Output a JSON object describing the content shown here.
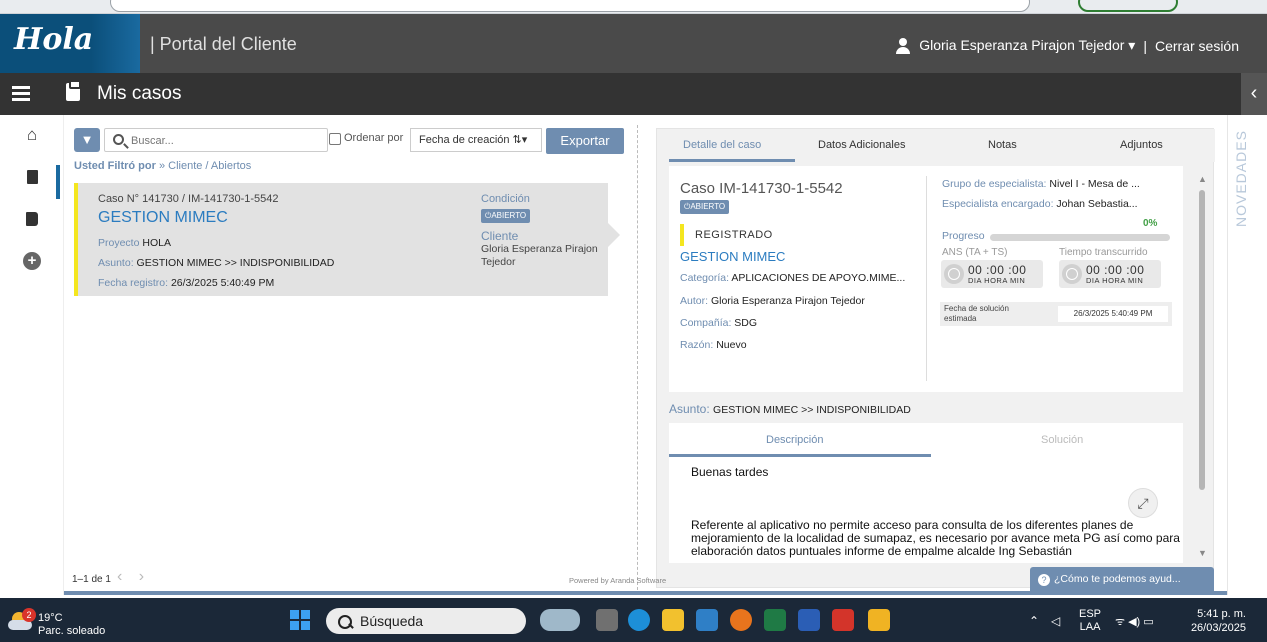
{
  "header": {
    "logo_text": "Hola",
    "portal_title": "| Portal del Cliente",
    "user_name": "Gloria Esperanza Pirajon Tejedor ▾",
    "separator": "|",
    "logout": "Cerrar sesión"
  },
  "subbar": {
    "title": "Mis casos"
  },
  "toolbar": {
    "search_placeholder": "Buscar...",
    "order_label": "Ordenar por",
    "order_value": "Fecha de creación ⇅▾",
    "export_label": "Exportar"
  },
  "filter": {
    "label": "Usted Filtró por",
    "value": " » Cliente / Abiertos"
  },
  "case_card": {
    "number": "Caso N° 141730 / IM-141730-1-5542",
    "title": "GESTION MIMEC",
    "project_label": "Proyecto ",
    "project_value": "HOLA",
    "subject_label": "Asunto: ",
    "subject_value": "GESTION MIMEC >> INDISPONIBILIDAD",
    "date_label": "Fecha registro: ",
    "date_value": "26/3/2025 5:40:49 PM",
    "condition_label": "Condición",
    "condition_badge": "⏻ABIERTO",
    "client_label": "Cliente",
    "client_value": "Gloria Esperanza Pirajon Tejedor"
  },
  "pager": {
    "text": "1–1 de 1",
    "arrows": "‹ ›"
  },
  "detail": {
    "tabs": [
      "Detalle del caso",
      "Datos Adicionales",
      "Notas",
      "Adjuntos"
    ],
    "case_id": "Caso IM-141730-1-5542",
    "badge": "⏻ABIERTO",
    "status": "REGISTRADO",
    "case_name": "GESTION MIMEC",
    "category_label": "Categoría: ",
    "category_value": "APLICACIONES DE APOYO.MIME...",
    "author_label": "Autor: ",
    "author_value": "Gloria Esperanza Pirajon Tejedor",
    "company_label": "Compañía: ",
    "company_value": "SDG",
    "reason_label": "Razón: ",
    "reason_value": "Nuevo",
    "group_label": "Grupo de especialista: ",
    "group_value": "Nivel I - Mesa de ...",
    "specialist_label": "Especialista encargado: ",
    "specialist_value": "Johan Sebastia...",
    "progress_pct": "0%",
    "progress_value": 0,
    "progress_label": "Progreso",
    "ans_label": "ANS (TA + TS)",
    "elapsed_label": "Tiempo transcurrido",
    "ans_time": "00 :00 :00",
    "elapsed_time": "00 :00 :00",
    "time_units": "DIA  HORA  MIN",
    "est_label": "Fecha de solución estimada",
    "est_value": "26/3/2025 5:40:49 PM",
    "asunto_label": "Asunto: ",
    "asunto_value": "GESTION MIMEC >> INDISPONIBILIDAD",
    "desc_tab": "Descripción",
    "sol_tab": "Solución",
    "desc_greeting": "Buenas tardes",
    "desc_body": "Referente al aplicativo no permite acceso para consulta de los diferentes planes de mejoramiento de la localidad de sumapaz, es necesario por avance meta PG así como para elaboración datos puntuales informe de empalme alcalde Ing Sebastián"
  },
  "side": {
    "novedades": "NOVEDADES"
  },
  "footer": {
    "powered": "Powered by Aranda Software",
    "help": "¿Cómo te podemos ayud..."
  },
  "taskbar": {
    "weather_temp": "19°C",
    "weather_desc": "Parc. soleado",
    "notif_count": "2",
    "search": "Búsqueda",
    "lang": "ESP",
    "lang2": "LAA",
    "time": "5:41 p. m.",
    "date": "26/03/2025"
  }
}
